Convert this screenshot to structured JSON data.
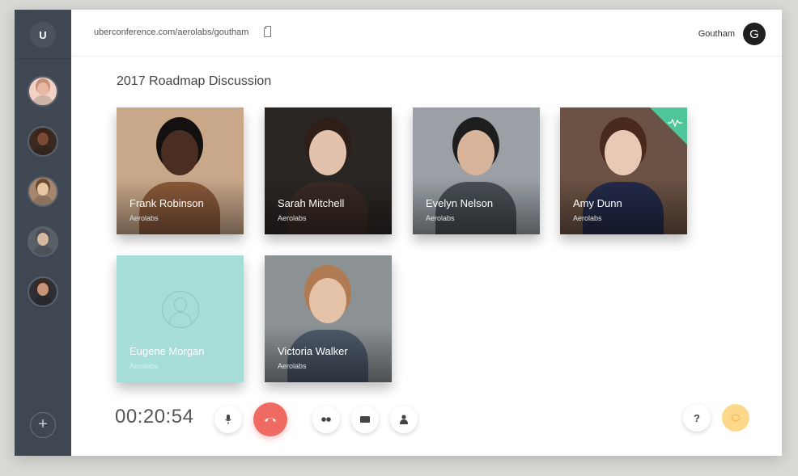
{
  "sidebar": {
    "logo": "U",
    "participants": [
      {
        "skin": "#e7b9a4",
        "hair": "#c98f77",
        "shirt": "#f2d2c5"
      },
      {
        "skin": "#7a4b34",
        "hair": "#3b2216",
        "shirt": "#3b2a22"
      },
      {
        "skin": "#e8c6a3",
        "hair": "#6b4a32",
        "shirt": "#a6876d"
      },
      {
        "skin": "#d6b8a0",
        "hair": "#4e4e57",
        "shirt": "#596068"
      },
      {
        "skin": "#c89478",
        "hair": "#3a2a22",
        "shirt": "#2e3036"
      }
    ],
    "add_label": "+"
  },
  "topbar": {
    "url": "uberconference.com/aerolabs/goutham",
    "username": "Goutham",
    "avatar_initial": "G"
  },
  "conference": {
    "title": "2017 Roadmap Discussion",
    "participants": [
      {
        "name": "Frank Robinson",
        "org": "Aerolabs",
        "bg": "#c9a88a",
        "skin": "#4a2e22",
        "hair": "#141010",
        "shirt": "#8a5a3a"
      },
      {
        "name": "Sarah Mitchell",
        "org": "Aerolabs",
        "bg": "#2a2624",
        "skin": "#e2c2ad",
        "hair": "#2d1f18",
        "shirt": "#3a2a24"
      },
      {
        "name": "Evelyn Nelson",
        "org": "Aerolabs",
        "bg": "#9aa0a6",
        "skin": "#d8b59a",
        "hair": "#1e1e1e",
        "shirt": "#4a4f55"
      },
      {
        "name": "Amy Dunn",
        "org": "Aerolabs",
        "bg": "#6b5244",
        "skin": "#e8c9b4",
        "hair": "#4a2a1e",
        "shirt": "#232b4a",
        "speaking": true
      },
      {
        "name": "Eugene Morgan",
        "org": "Aerolabs",
        "bg": "#a6ddd8",
        "placeholder": true
      },
      {
        "name": "Victoria Walker",
        "org": "Aerolabs",
        "bg": "#8c9194",
        "skin": "#e4c3a8",
        "hair": "#b07a52",
        "shirt": "#4d5a6a"
      }
    ]
  },
  "controls": {
    "timer": "00:20:54",
    "help_label": "?",
    "accent": "#ef6a62",
    "chat_color": "#fcd98a"
  }
}
